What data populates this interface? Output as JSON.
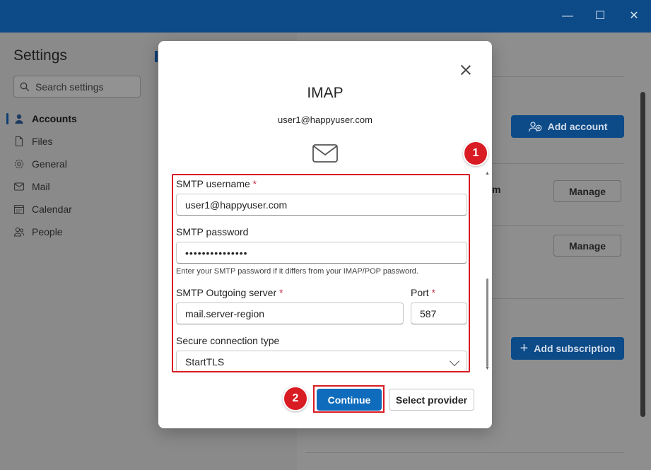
{
  "window": {
    "minimize_glyph": "—",
    "maximize_glyph": "☐",
    "close_glyph": "✕"
  },
  "sidebar": {
    "title": "Settings",
    "search_placeholder": "Search settings",
    "items": [
      {
        "label": "Accounts",
        "icon": "person-icon",
        "active": true
      },
      {
        "label": "Files",
        "icon": "file-icon"
      },
      {
        "label": "General",
        "icon": "gear-icon"
      },
      {
        "label": "Mail",
        "icon": "mail-icon"
      },
      {
        "label": "Calendar",
        "icon": "calendar-icon"
      },
      {
        "label": "People",
        "icon": "people-icon"
      }
    ]
  },
  "background_content": {
    "add_account_label": "Add account",
    "manage_label_1": "Manage",
    "manage_label_2": "Manage",
    "add_subscription_label": "Add subscription",
    "partial_text": "m"
  },
  "dialog": {
    "title": "IMAP",
    "email": "user1@happyuser.com",
    "fields": {
      "smtp_username_label": "SMTP username",
      "smtp_username_value": "user1@happyuser.com",
      "smtp_password_label": "SMTP password",
      "smtp_password_value": "•••••••••••••••",
      "smtp_password_hint": "Enter your SMTP password if it differs from your IMAP/POP password.",
      "smtp_server_label": "SMTP Outgoing server",
      "smtp_server_value": "mail.server-region",
      "port_label": "Port",
      "port_value": "587",
      "secure_label": "Secure connection type",
      "secure_value": "StartTLS"
    },
    "required_marker": "*",
    "continue_label": "Continue",
    "select_provider_label": "Select provider"
  },
  "annotations": {
    "badge_1": "1",
    "badge_2": "2"
  },
  "colors": {
    "accent": "#0f6cbd",
    "titlebar": "#0c4a88",
    "highlight": "#d91b23",
    "required": "#c4314b"
  }
}
